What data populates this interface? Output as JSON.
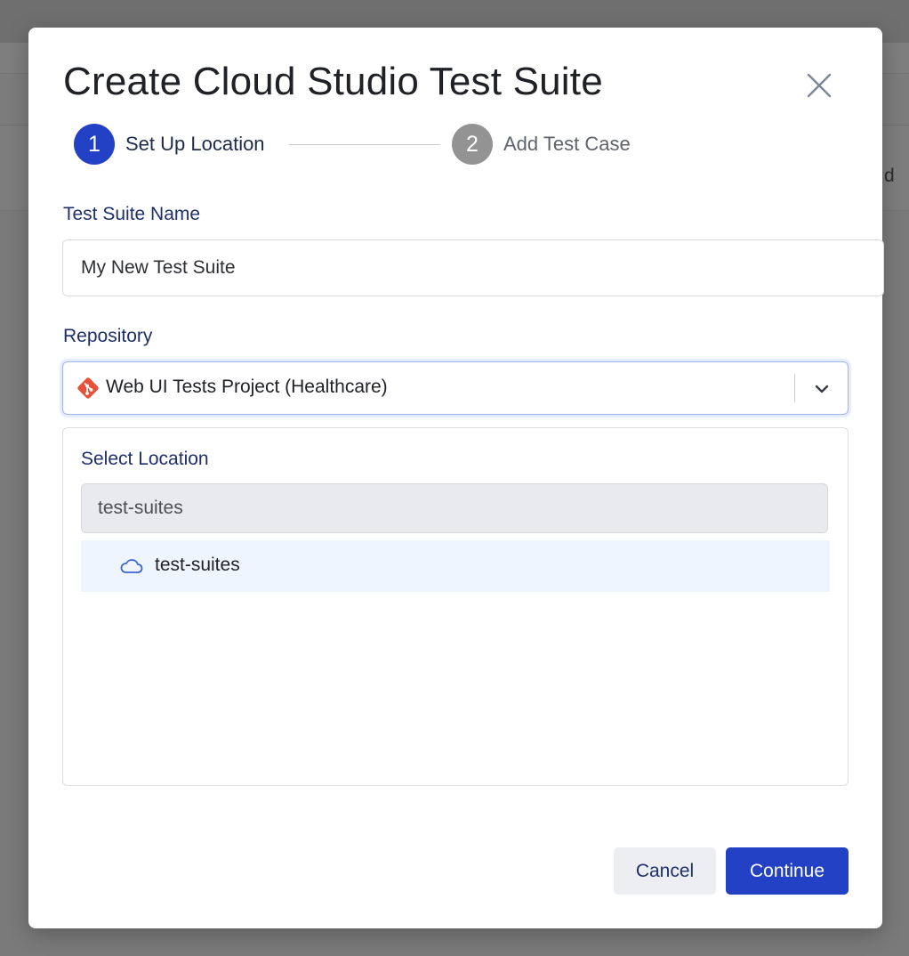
{
  "background": {
    "peek_text": "d"
  },
  "modal": {
    "title": "Create Cloud Studio Test Suite",
    "close_icon": "close-icon"
  },
  "stepper": {
    "steps": [
      {
        "number": "1",
        "label": "Set Up Location",
        "state": "active"
      },
      {
        "number": "2",
        "label": "Add Test Case",
        "state": "inactive"
      }
    ]
  },
  "form": {
    "name_label": "Test Suite Name",
    "name_value": "My New Test Suite",
    "repo_label": "Repository",
    "repo_value": "Web UI Tests Project (Healthcare)",
    "repo_icon": "git-icon",
    "location_label": "Select Location",
    "location_search_value": "test-suites",
    "location_items": [
      {
        "label": "test-suites",
        "icon": "cloud-icon",
        "selected": true
      }
    ]
  },
  "footer": {
    "cancel_label": "Cancel",
    "continue_label": "Continue"
  },
  "colors": {
    "primary": "#2341c4",
    "label": "#1e2f6b",
    "selected_row": "#eef5fe",
    "git_orange": "#e8513a"
  }
}
